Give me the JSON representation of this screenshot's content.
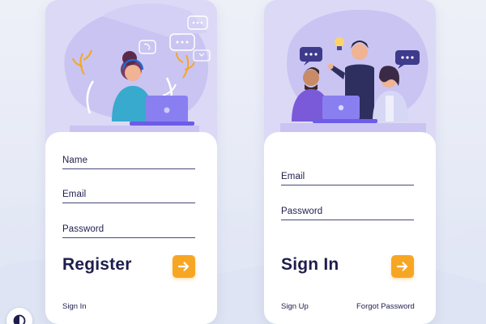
{
  "register_card": {
    "fields": {
      "name_label": "Name",
      "email_label": "Email",
      "password_label": "Password"
    },
    "title": "Register",
    "signin_link": "Sign In",
    "illustration_icon": "support-agent-illustration"
  },
  "signin_card": {
    "fields": {
      "email_label": "Email",
      "password_label": "Password"
    },
    "title": "Sign In",
    "signup_link": "Sign Up",
    "forgot_link": "Forgot Password",
    "illustration_icon": "team-meeting-illustration"
  },
  "colors": {
    "accent": "#f7a623",
    "text": "#1f1d4d",
    "card_bg": "#dcd9f6",
    "purple": "#6c5ce7"
  },
  "theme_toggle_icon": "contrast-icon"
}
